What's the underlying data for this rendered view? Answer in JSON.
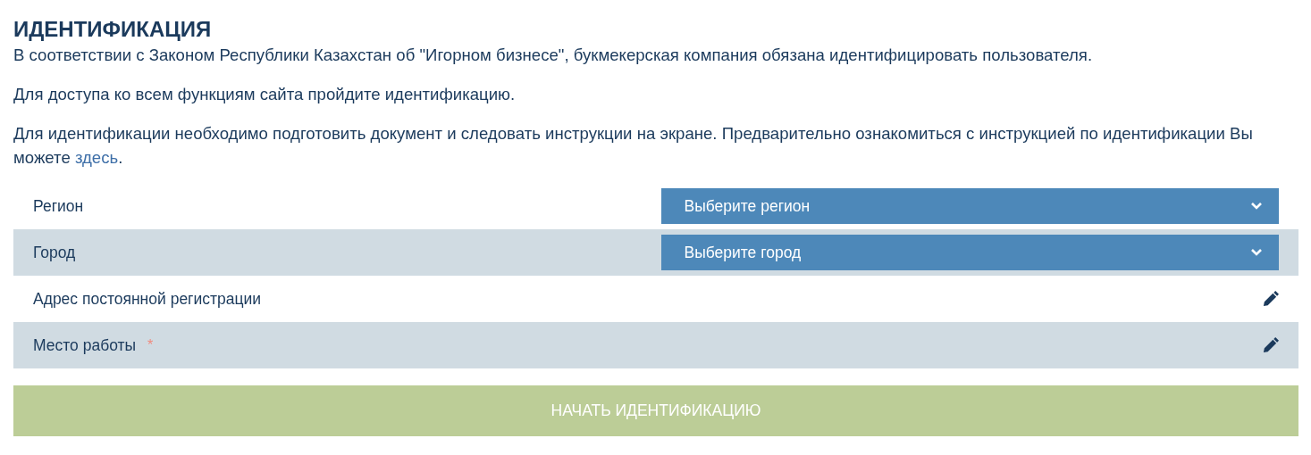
{
  "title": "ИДЕНТИФИКАЦИЯ",
  "paragraphs": [
    {
      "text": "В соответствии с Законом Республики Казахстан об \"Игорном бизнесе\", букмекерская компания обязана идентифицировать пользователя."
    },
    {
      "text": "Для доступа ко всем функциям сайта пройдите идентификацию."
    },
    {
      "text": "Для идентификации необходимо подготовить документ и следовать инструкции на экране. Предварительно ознакомиться с инструкцией по идентификации Вы можете ",
      "link": "здесь",
      "after": "."
    }
  ],
  "rows": [
    {
      "kind": "select",
      "label": "Регион",
      "value": "Выберите регион"
    },
    {
      "kind": "select",
      "label": "Город",
      "value": "Выберите город"
    },
    {
      "kind": "text",
      "label": "Адрес постоянной регистрации"
    },
    {
      "kind": "text",
      "label": "Место работы",
      "required_mark": "*"
    }
  ],
  "submit": {
    "label": "НАЧАТЬ ИДЕНТИФИКАЦИЮ",
    "disabled": true
  }
}
